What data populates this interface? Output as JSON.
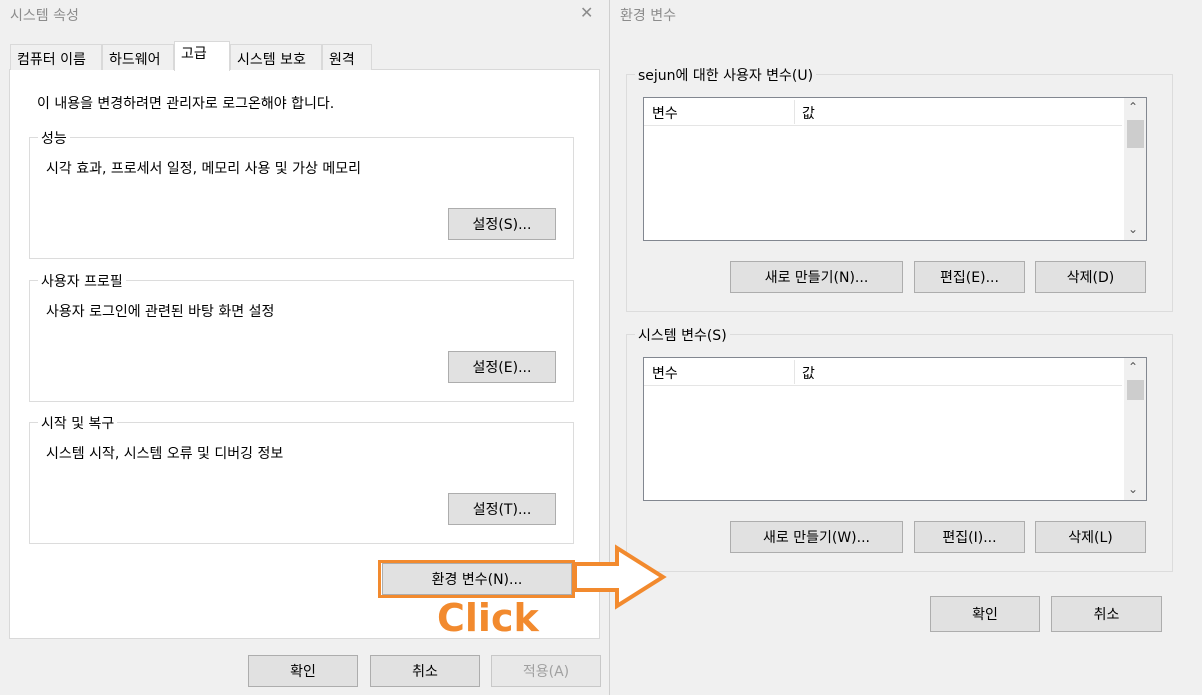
{
  "system_properties": {
    "title": "시스템 속성",
    "close_glyph": "✕",
    "tabs": [
      {
        "label": "컴퓨터 이름",
        "active": false
      },
      {
        "label": "하드웨어",
        "active": false
      },
      {
        "label": "고급",
        "active": true
      },
      {
        "label": "시스템 보호",
        "active": false
      },
      {
        "label": "원격",
        "active": false
      }
    ],
    "admin_note": "이 내용을 변경하려면 관리자로 로그온해야 합니다.",
    "performance": {
      "title": "성능",
      "description": "시각 효과, 프로세서 일정, 메모리 사용 및 가상 메모리",
      "button": "설정(S)..."
    },
    "user_profile": {
      "title": "사용자 프로필",
      "description": "사용자 로그인에 관련된 바탕 화면 설정",
      "button": "설정(E)..."
    },
    "startup_recovery": {
      "title": "시작 및 복구",
      "description": "시스템 시작, 시스템 오류 및 디버깅 정보",
      "button": "설정(T)..."
    },
    "env_button": "환경 변수(N)...",
    "ok": "확인",
    "cancel": "취소",
    "apply": "적용(A)"
  },
  "env_vars": {
    "title": "환경 변수",
    "user_section": {
      "title": "sejun에 대한 사용자 변수(U)",
      "col_variable": "변수",
      "col_value": "값",
      "new_button": "새로 만들기(N)...",
      "edit_button": "편집(E)...",
      "delete_button": "삭제(D)"
    },
    "system_section": {
      "title": "시스템 변수(S)",
      "col_variable": "변수",
      "col_value": "값",
      "new_button": "새로 만들기(W)...",
      "edit_button": "편집(I)...",
      "delete_button": "삭제(L)"
    },
    "ok": "확인",
    "cancel": "취소"
  },
  "annotation": {
    "label": "Click",
    "color": "#f28a2e"
  }
}
